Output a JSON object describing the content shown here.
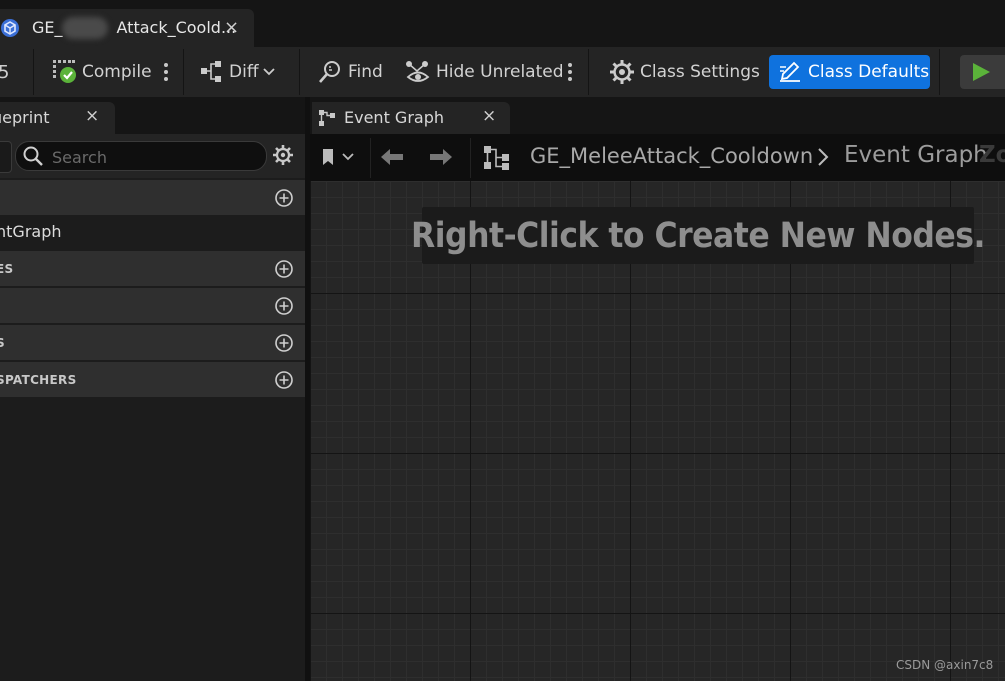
{
  "document_tab": {
    "title": "GE_",
    "title_rest": "Attack_Coold...",
    "close": "×"
  },
  "toolbar": {
    "partial_left_icon": "5",
    "compile": "Compile",
    "diff": "Diff",
    "find": "Find",
    "hide_unrelated": "Hide Unrelated",
    "class_settings": "Class Settings",
    "class_defaults": "Class Defaults"
  },
  "left_panel": {
    "tab_label": "ueprint",
    "tab_close": "×",
    "search_placeholder": "Search",
    "categories": [
      {
        "label": ""
      },
      {
        "label": "ES"
      },
      {
        "label": ""
      },
      {
        "label": "S"
      },
      {
        "label": "SPATCHERS"
      }
    ],
    "graph_item": "ntGraph"
  },
  "graph": {
    "tab_label": "Event Graph",
    "tab_close": "×",
    "breadcrumb_blueprint": "GE_MeleeAttack_Cooldown",
    "breadcrumb_graph": "Event Graph",
    "zoom_partial": "Zo",
    "hint": "Right-Click to Create New Nodes."
  },
  "watermark": "CSDN @axin7c8",
  "colors": {
    "accent": "#0f72de",
    "compile_ok": "#5bb33a",
    "play": "#5bb33a"
  }
}
